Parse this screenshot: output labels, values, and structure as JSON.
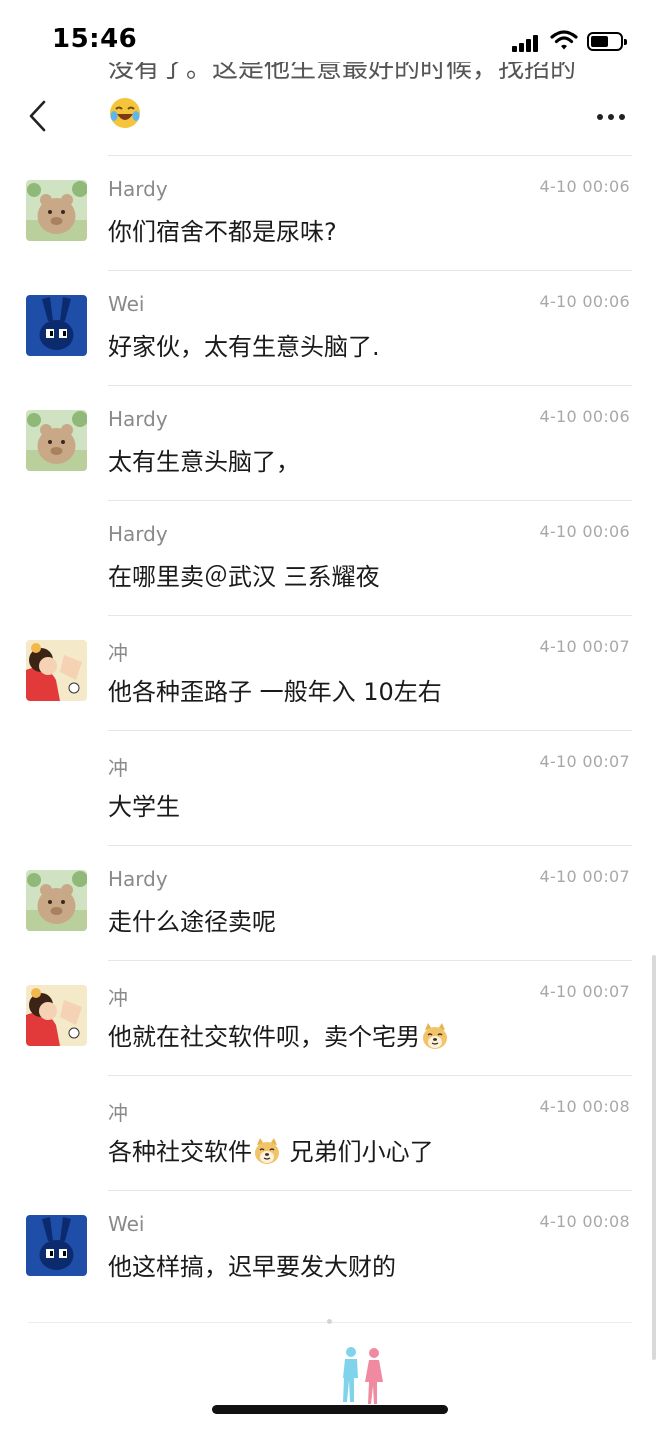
{
  "status_bar": {
    "time": "15:46",
    "battery_level": 0.6
  },
  "header": {
    "back_icon": "chevron-left-icon",
    "more_icon": "more-horizontal-icon"
  },
  "previous_message": {
    "partial_text": "没有了。这是他生意最好的时候，找招的",
    "emoji": "laughing-crying-face"
  },
  "messages": [
    {
      "name": "Hardy",
      "time": "4-10 00:06",
      "text": "你们宿舍不都是尿味?",
      "avatar": "hardy-bear-avatar",
      "show_avatar": true
    },
    {
      "name": "Wei",
      "time": "4-10 00:06",
      "text": "好家伙，太有生意头脑了.",
      "avatar": "wei-blue-rabbit-avatar",
      "show_avatar": true
    },
    {
      "name": "Hardy",
      "time": "4-10 00:06",
      "text": "太有生意头脑了，",
      "avatar": "hardy-bear-avatar",
      "show_avatar": true
    },
    {
      "name": "Hardy",
      "time": "4-10 00:06",
      "text": "在哪里卖＠武汉 三系耀夜",
      "avatar": "",
      "show_avatar": false
    },
    {
      "name": "冲",
      "time": "4-10 00:07",
      "text": "他各种歪路子 一般年入 10左右",
      "avatar": "chong-cartoon-avatar",
      "show_avatar": true
    },
    {
      "name": "冲",
      "time": "4-10 00:07",
      "text": "大学生",
      "avatar": "",
      "show_avatar": false
    },
    {
      "name": "Hardy",
      "time": "4-10 00:07",
      "text": "走什么途径卖呢",
      "avatar": "hardy-bear-avatar",
      "show_avatar": true
    },
    {
      "name": "冲",
      "time": "4-10 00:07",
      "text": "他就在社交软件呗，卖个宅男",
      "emoji_after": "doge-icon",
      "avatar": "chong-cartoon-avatar",
      "show_avatar": true
    },
    {
      "name": "冲",
      "time": "4-10 00:08",
      "text": "各种社交软件",
      "emoji_mid": "doge-icon",
      "text_after": " 兄弟们小心了",
      "avatar": "",
      "show_avatar": false
    },
    {
      "name": "Wei",
      "time": "4-10 00:08",
      "text": "他这样搞，迟早要发大财的",
      "avatar": "wei-blue-rabbit-avatar",
      "show_avatar": true
    }
  ],
  "bottom": {
    "icon": "couple-silhouette-icon",
    "colors": {
      "male": "#7fd3ea",
      "female": "#f08aa0"
    }
  }
}
